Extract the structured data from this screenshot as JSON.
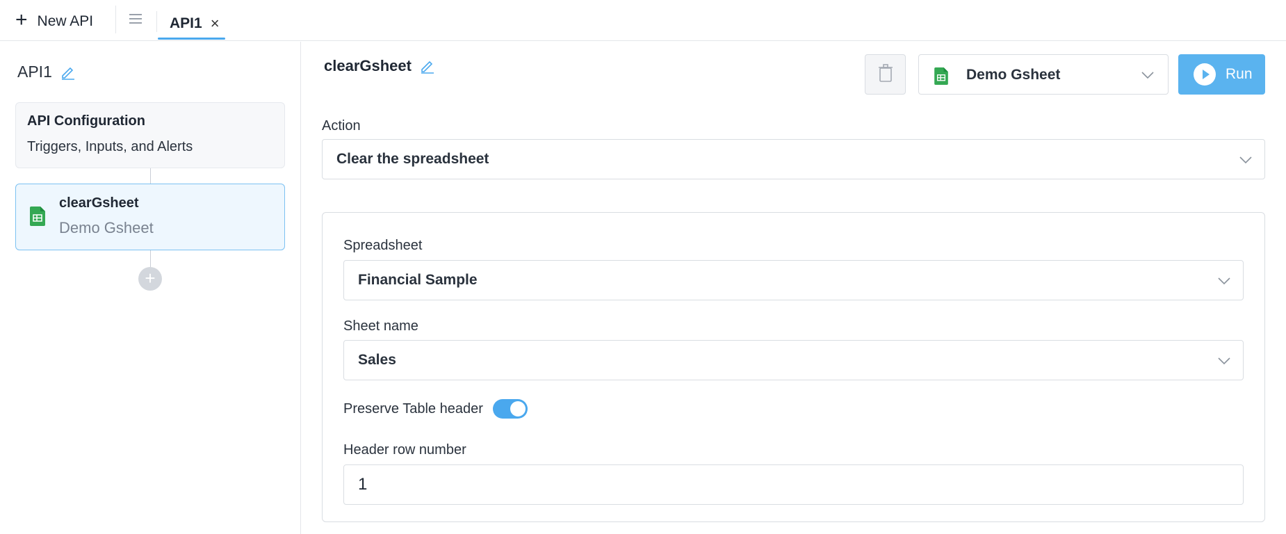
{
  "topbar": {
    "new_api_label": "New API",
    "tabs": [
      {
        "label": "API1",
        "active": true
      }
    ]
  },
  "sidebar": {
    "api_name": "API1",
    "config_card": {
      "title": "API Configuration",
      "subtitle": "Triggers, Inputs, and Alerts"
    },
    "steps": [
      {
        "name": "clearGsheet",
        "integration": "Demo Gsheet",
        "icon": "google-sheets-icon",
        "selected": true
      }
    ]
  },
  "main": {
    "step_name": "clearGsheet",
    "integration_select": {
      "value": "Demo Gsheet",
      "icon": "google-sheets-icon"
    },
    "run_label": "Run",
    "action": {
      "label": "Action",
      "value": "Clear the spreadsheet"
    },
    "spreadsheet": {
      "label": "Spreadsheet",
      "value": "Financial Sample"
    },
    "sheet_name": {
      "label": "Sheet name",
      "value": "Sales"
    },
    "preserve_header": {
      "label": "Preserve Table header",
      "enabled": true
    },
    "header_row": {
      "label": "Header row number",
      "value": "1"
    }
  },
  "colors": {
    "accent": "#4aa8ee",
    "run_button": "#5ab3ef",
    "sheets_green": "#34a853",
    "selected_card_bg": "#eef7fe"
  }
}
